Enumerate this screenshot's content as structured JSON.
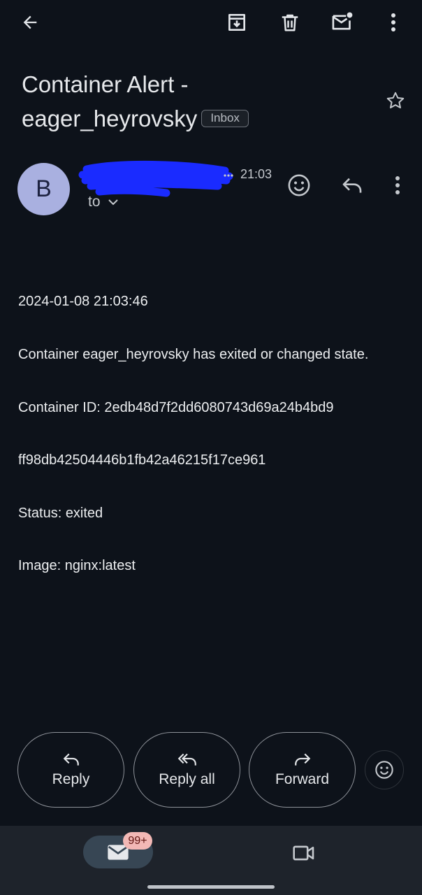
{
  "toolbar": {
    "back_icon": "arrow-left-icon",
    "archive_icon": "archive-icon",
    "delete_icon": "trash-icon",
    "mark_unread_icon": "mail-unread-icon",
    "more_icon": "more-vert-icon"
  },
  "subject": {
    "line1": "Container Alert -",
    "line2": "eager_heyrovsky",
    "label": "Inbox"
  },
  "sender": {
    "avatar_letter": "B",
    "time": "21:03",
    "to_label": "to"
  },
  "body": {
    "lines": [
      "2024-01-08 21:03:46",
      "Container eager_heyrovsky has exited or changed state.",
      "Container ID: 2edb48d7f2dd6080743d69a24b4bd9",
      "ff98db42504446b1fb42a46215f17ce961",
      "Status: exited",
      "Image: nginx:latest"
    ]
  },
  "actions": {
    "reply": "Reply",
    "reply_all": "Reply all",
    "forward": "Forward"
  },
  "bottom_nav": {
    "mail_badge": "99+"
  },
  "colors": {
    "background": "#0d121a",
    "avatar": "#a9b0e0",
    "nav_bar": "#1e232b",
    "mail_pill": "#374654",
    "badge": "#f2b8b5",
    "redaction": "#1a2bff"
  }
}
